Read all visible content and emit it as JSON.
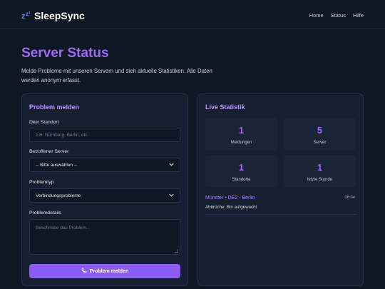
{
  "header": {
    "logo_glyph": "💤",
    "brand": "SleepSync",
    "nav": [
      "Home",
      "Status",
      "Hilfe"
    ]
  },
  "hero": {
    "title": "Server Status",
    "description": "Melde Probleme mit unseren Servern und sieh aktuelle Statistiken. Alle Daten werden anonym erfasst."
  },
  "form": {
    "heading": "Problem melden",
    "location_label": "Dein Standort",
    "location_placeholder": "z.B. Nürnberg, Berlin, etc.",
    "server_label": "Betroffener Server",
    "server_value": "-- Bitte auswählen --",
    "type_label": "Problemtyp",
    "type_value": "Verbindungsprobleme",
    "details_label": "Problemdetails",
    "details_placeholder": "Beschreibe das Problem...",
    "submit_label": "Problem melden",
    "submit_icon": "phone-icon"
  },
  "stats": {
    "heading": "Live Statistik",
    "tiles": [
      {
        "value": "1",
        "label": "Meldungen"
      },
      {
        "value": "5",
        "label": "Server"
      },
      {
        "value": "1",
        "label": "Standorte"
      },
      {
        "value": "1",
        "label": "letzte Stunde"
      }
    ],
    "reports": [
      {
        "location": "Münster • DE2 - Berlin",
        "time": "08:04",
        "message": "Abbrüche: Bin aufgewacht"
      }
    ]
  },
  "colors": {
    "background": "#0f1624",
    "card": "#151f30",
    "accent": "#8b5cf6",
    "accent_text": "#9b6cf0"
  }
}
